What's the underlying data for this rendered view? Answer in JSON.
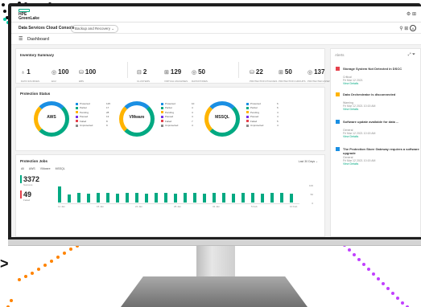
{
  "brand": {
    "line1": "HPE",
    "line2": "GreenLake"
  },
  "header": {
    "console": "Data Services Cloud Console",
    "service_select": "Backup and Recovery ⌄",
    "icons": "⚲ ⊞",
    "avatar": "A"
  },
  "nav": {
    "menu": "☰",
    "title": "Dashboard"
  },
  "inventory": {
    "title": "Inventory Summary",
    "stats": [
      {
        "icon": "♁",
        "value": "1",
        "label": "DATA SOURCES"
      },
      {
        "icon": "◎",
        "value": "100",
        "label": "EC2"
      },
      {
        "icon": "⛁",
        "value": "100",
        "label": "EBS"
      },
      {
        "icon": "⊟",
        "value": "2",
        "label": "CLUSTERS"
      },
      {
        "icon": "⊞",
        "value": "129",
        "label": "VIRTUAL MACHINES"
      },
      {
        "icon": "◎",
        "value": "50",
        "label": "DATASTORES"
      },
      {
        "icon": "⛁",
        "value": "22",
        "label": "PROTECTION POLICIES"
      },
      {
        "icon": "⊞",
        "value": "50",
        "label": "PROTECTION GROUPS"
      },
      {
        "icon": "◎",
        "value": "137",
        "label": "PROTECTED ASSETS"
      }
    ]
  },
  "protection": {
    "title": "Protection Status",
    "donuts": [
      {
        "label": "AWS",
        "legend": [
          [
            "Protected",
            "125"
          ],
          [
            "Partial",
            "17"
          ],
          [
            "Pending",
            "28"
          ],
          [
            "Paused",
            "13"
          ],
          [
            "Failed",
            "8"
          ],
          [
            "Unprotected",
            "9"
          ]
        ]
      },
      {
        "label": "VMware",
        "legend": [
          [
            "Protected",
            "10"
          ],
          [
            "Partial",
            "4"
          ],
          [
            "Pending",
            "4"
          ],
          [
            "Paused",
            "4"
          ],
          [
            "Failed",
            "7"
          ],
          [
            "Unprotected",
            "4"
          ]
        ]
      },
      {
        "label": "MSSQL",
        "legend": [
          [
            "Protected",
            "6"
          ],
          [
            "Partial",
            "6"
          ],
          [
            "Pending",
            "4"
          ],
          [
            "Paused",
            "4"
          ],
          [
            "Failed",
            "5"
          ],
          [
            "Unprotected",
            "4"
          ]
        ]
      }
    ],
    "legend_colors": [
      "#1a8fe3",
      "#01a982",
      "#ffb400",
      "#7630ea",
      "#e5424d",
      "#888888"
    ]
  },
  "jobs": {
    "title": "Protection Jobs",
    "range": "Last 30 Days ⌄",
    "tabs": [
      "All",
      "AWS",
      "VMware",
      "MSSQL"
    ],
    "success_value": "3372",
    "success_label": "Success",
    "failed_value": "49",
    "failed_label": "Failed",
    "x_labels": [
      "11 Jan",
      "16 Jan",
      "21 Jan",
      "26 Jan",
      "31 Jan",
      "5 Feb",
      "10 Feb"
    ],
    "y_labels": [
      "100",
      "50",
      "0"
    ]
  },
  "alerts": {
    "title": "Alerts",
    "icons": "⤢ ⏷",
    "items": [
      {
        "color": "#e5424d",
        "title": "Storage System Not Detected in DSCC",
        "sub1": "Critical",
        "sub2": "Fri Mar 12 2021",
        "link": "View Details"
      },
      {
        "color": "#ffb400",
        "title": "Data Orchestrator is disconnected",
        "sub1": "Warning",
        "sub2": "Fri Mar 12 2021 10:15 AM",
        "link": "View Details"
      },
      {
        "color": "#1a8fe3",
        "title": "Software update available for data ...",
        "sub1": "General",
        "sub2": "Fri Mar 12 2021 10:15 AM",
        "link": "View Details"
      },
      {
        "color": "#1a8fe3",
        "title": "The Protection Store Gateway requires a software upgrade",
        "sub1": "General",
        "sub2": "Fri Mar 12 2021 10:15 AM",
        "link": "View Details"
      }
    ]
  },
  "decor": {
    "arrow": ">"
  }
}
